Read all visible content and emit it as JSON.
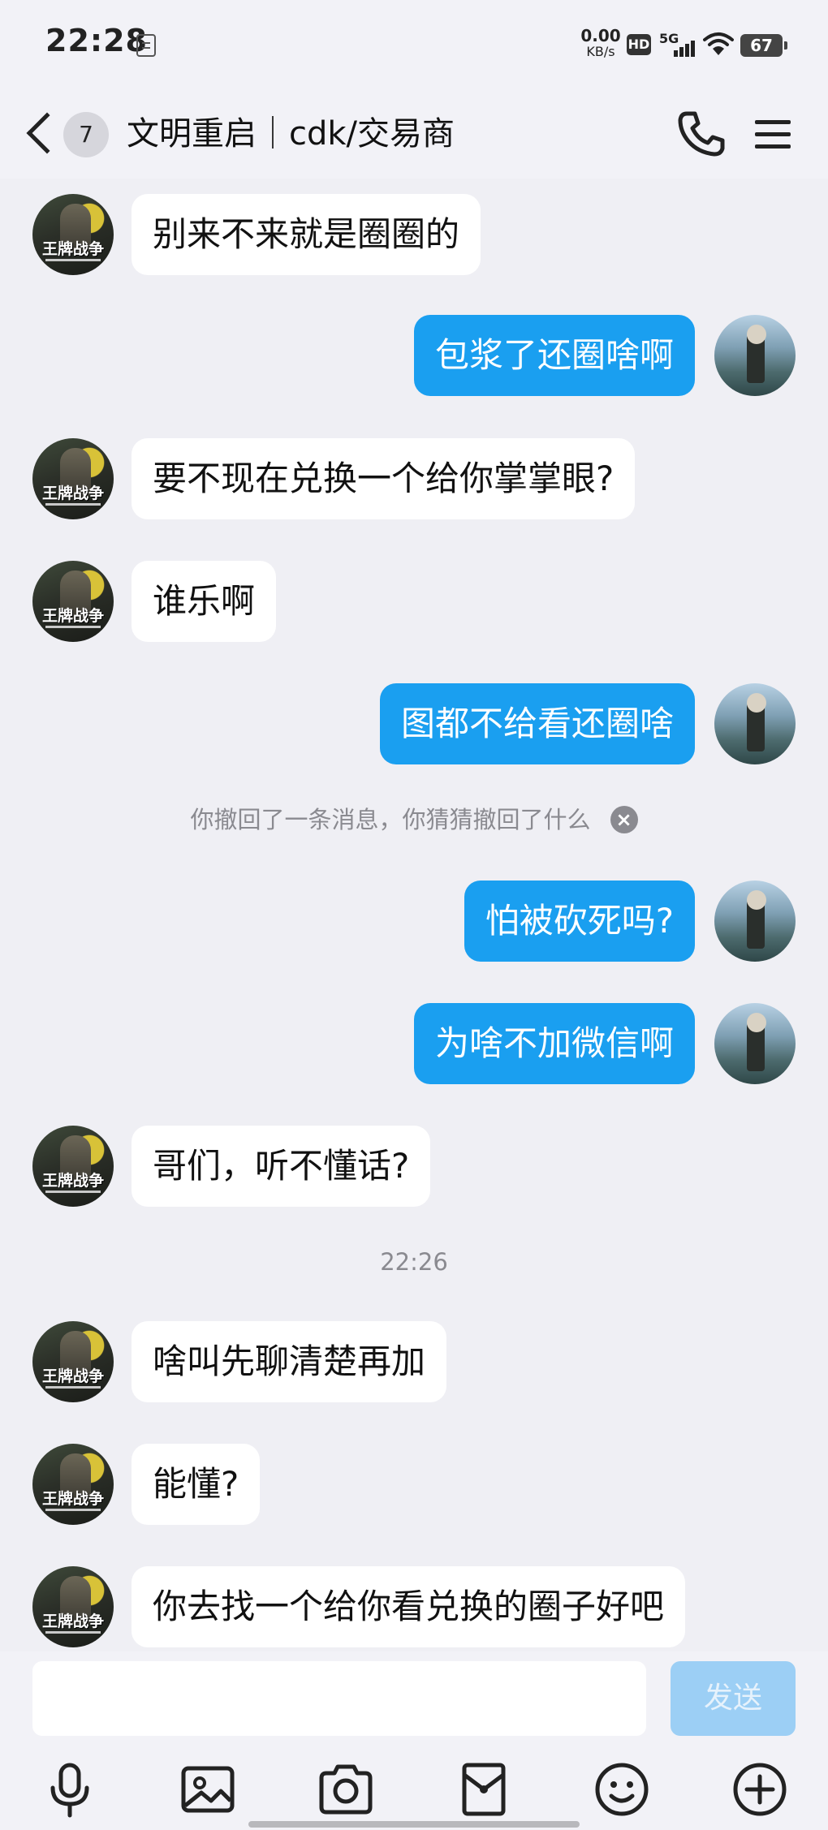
{
  "status_bar": {
    "time": "22:28",
    "net_speed_value": "0.00",
    "net_speed_unit": "KB/s",
    "hd_label": "HD",
    "signal_label": "5G",
    "battery": "67"
  },
  "header": {
    "unread_count": "7",
    "title": "文明重启｜cdk/交易商"
  },
  "avatar_game_text": "王牌战争",
  "messages": [
    {
      "side": "left",
      "text": "别来不来就是圈圈的"
    },
    {
      "side": "right",
      "text": "包浆了还圈啥啊"
    },
    {
      "side": "left",
      "text": "要不现在兑换一个给你掌掌眼?"
    },
    {
      "side": "left",
      "text": "谁乐啊"
    },
    {
      "side": "right",
      "text": "图都不给看还圈啥"
    },
    {
      "side": "right",
      "text": "怕被砍死吗?"
    },
    {
      "side": "right",
      "text": "为啥不加微信啊"
    },
    {
      "side": "left",
      "text": "哥们，听不懂话?"
    },
    {
      "side": "left",
      "text": "啥叫先聊清楚再加"
    },
    {
      "side": "left",
      "text": "能懂?"
    },
    {
      "side": "left",
      "text": "你去找一个给你看兑换的圈子好吧"
    }
  ],
  "recall_notice": "你撤回了一条消息，你猜猜撤回了什么",
  "timestamp": "22:26",
  "composer": {
    "input_value": "",
    "send_label": "发送"
  },
  "toolbar_icons": [
    "microphone-icon",
    "image-icon",
    "camera-icon",
    "red-packet-icon",
    "emoji-icon",
    "plus-icon"
  ],
  "colors": {
    "outgoing_bubble": "#1a9ff0",
    "incoming_bubble": "#ffffff",
    "background": "#efeff4",
    "send_button_disabled": "#9ccff5"
  }
}
